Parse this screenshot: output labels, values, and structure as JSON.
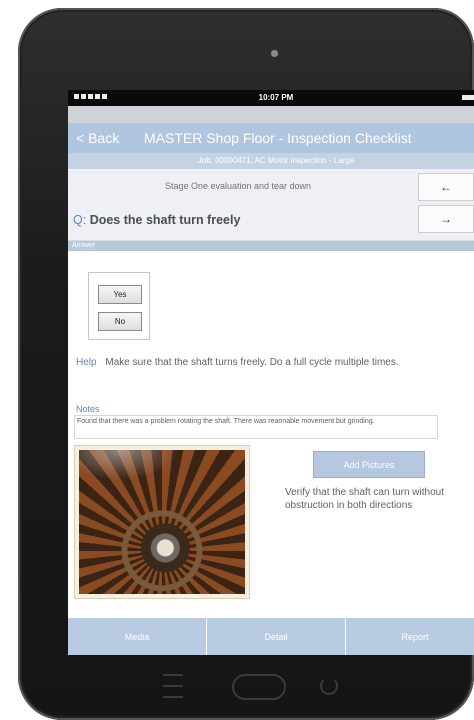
{
  "status_bar": {
    "time": "10:07 PM"
  },
  "header": {
    "back_label": "< Back",
    "title": "MASTER Shop Floor - Inspection Checklist",
    "job": "Job: 00000471, AC Motor inspection - Large"
  },
  "question": {
    "stage": "Stage One evaluation and tear down",
    "prefix": "Q:",
    "text": "Does the shaft turn freely",
    "prev_icon": "←",
    "next_icon": "→"
  },
  "answer": {
    "section_label": "Answer",
    "options": [
      "Yes",
      "No"
    ],
    "selected": "Yes"
  },
  "help": {
    "label": "Help",
    "text": "Make sure that the shaft turns freely. Do a full cycle multiple times."
  },
  "notes": {
    "label": "Notes",
    "value": "Found that there was a problem rotating the shaft. There was reaonable movement but grinding."
  },
  "media": {
    "add_pictures_label": "Add Pictures",
    "instruction": "Verify that the shaft can turn without obstruction in both directions"
  },
  "tabs": [
    "Media",
    "Detail",
    "Report"
  ],
  "colors": {
    "header_blue": "#b0c6df",
    "accent_blue": "#5b86c0",
    "tab_blue": "#b8cbe2"
  }
}
